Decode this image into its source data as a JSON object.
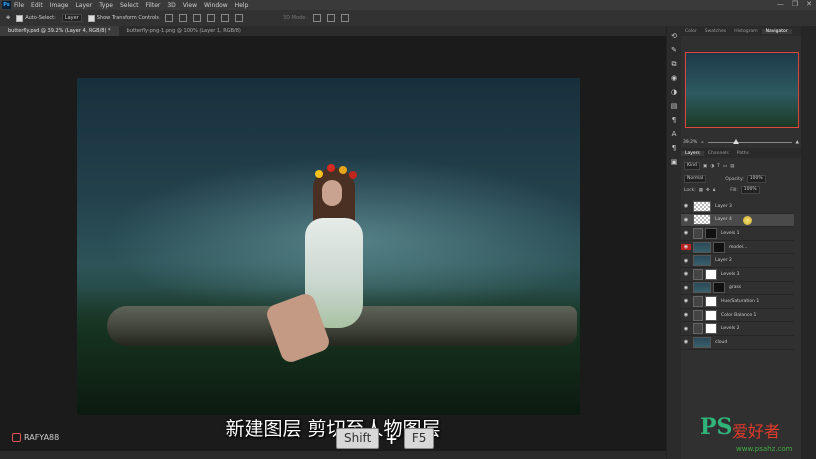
{
  "menubar": {
    "logo": "Ps",
    "items": [
      "File",
      "Edit",
      "Image",
      "Layer",
      "Type",
      "Select",
      "Filter",
      "3D",
      "View",
      "Window",
      "Help"
    ],
    "controls": [
      "—",
      "❐",
      "✕"
    ]
  },
  "options": {
    "auto_select": "Auto-Select:",
    "auto_select_value": "Layer",
    "show_transform": "Show Transform Controls",
    "mode3d": "3D Mode:"
  },
  "tabs": [
    "butterfly.psd @ 39.2% (Layer 4, RGB/8) *",
    "butterfly-png-1.png @ 100% (Layer 1, RGB/8)"
  ],
  "subtitle": "新建图层 剪切至人物图层",
  "keys": {
    "key1": "Shift",
    "plus": "+",
    "key2": "F5"
  },
  "watermark": "RAFYA88",
  "panel": {
    "top_tabs": [
      "Color",
      "Swatches",
      "Histogram",
      "Navigator"
    ],
    "zoom": "39.2%",
    "layer_tabs": [
      "Layers",
      "Channels",
      "Paths"
    ],
    "kind": "Kind",
    "blend": "Normal",
    "opacity_label": "Opacity:",
    "opacity": "100%",
    "lock_label": "Lock:",
    "fill_label": "Fill:",
    "fill": "100%"
  },
  "layers": [
    {
      "name": "Layer 3",
      "thumb": "check",
      "selected": false,
      "eye_red": false
    },
    {
      "name": "Layer 4",
      "thumb": "check",
      "selected": true,
      "eye_red": false
    },
    {
      "name": "Levels 1",
      "thumb": "adj",
      "selected": false,
      "eye_red": false
    },
    {
      "name": "model...",
      "thumb": "photo-th",
      "selected": false,
      "eye_red": true
    },
    {
      "name": "Layer 2",
      "thumb": "photo-th",
      "selected": false,
      "eye_red": false
    },
    {
      "name": "Levels 3",
      "thumb": "adj",
      "selected": false,
      "eye_red": false
    },
    {
      "name": "grass",
      "thumb": "photo-th",
      "selected": false,
      "eye_red": false
    },
    {
      "name": "Hue/Saturation 1",
      "thumb": "adj",
      "selected": false,
      "eye_red": false
    },
    {
      "name": "Color Balance 1",
      "thumb": "adj",
      "selected": false,
      "eye_red": false
    },
    {
      "name": "Levels 2",
      "thumb": "adj",
      "selected": false,
      "eye_red": false
    },
    {
      "name": "cloud",
      "thumb": "photo-th",
      "selected": false,
      "eye_red": false
    }
  ],
  "brand": {
    "logo": "PS",
    "cn": "爱好者",
    "url": "www.psahz.com"
  }
}
